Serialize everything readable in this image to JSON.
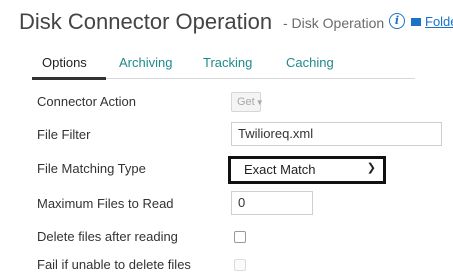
{
  "header": {
    "title": "Disk Connector Operation",
    "subtitle": "- Disk Operation",
    "info_icon": "info-icon",
    "folder_link": "Folde",
    "folder_icon": "folder-icon",
    "link_color": "#1a73c9"
  },
  "tabs": [
    {
      "label": "Options",
      "active": true
    },
    {
      "label": "Archiving",
      "active": false
    },
    {
      "label": "Tracking",
      "active": false
    },
    {
      "label": "Caching",
      "active": false
    }
  ],
  "fields": {
    "connector_action": {
      "label": "Connector Action",
      "value": "Get",
      "disabled": true
    },
    "file_filter": {
      "label": "File Filter",
      "value": "Twilioreq.xml"
    },
    "file_matching_type": {
      "label": "File Matching Type",
      "value": "Exact Match"
    },
    "max_files": {
      "label": "Maximum Files to Read",
      "value": "0"
    },
    "delete_after_reading": {
      "label": "Delete files after reading",
      "checked": false
    },
    "fail_if_unable_delete": {
      "label": "Fail if unable to delete files",
      "checked": false,
      "disabled": true
    }
  },
  "colors": {
    "tab_link": "#1f8a8a",
    "highlight_border": "#111111"
  }
}
